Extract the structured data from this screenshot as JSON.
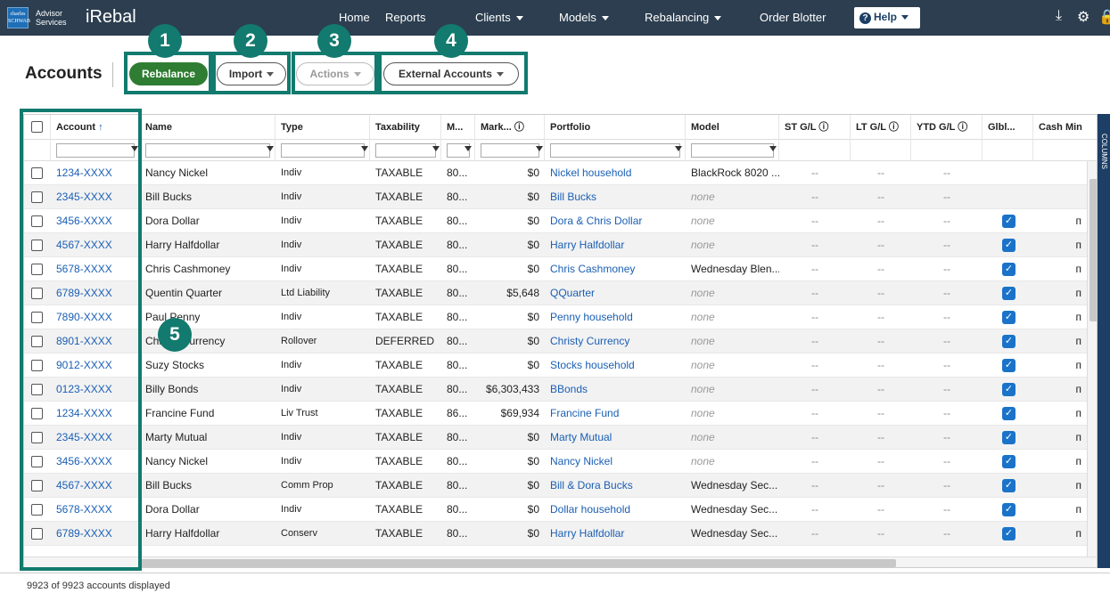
{
  "topnav": {
    "logo_text": "charles SCHWAB",
    "advisor_line1": "Advisor",
    "advisor_line2": "Services",
    "brand": "iRebal",
    "items": [
      {
        "label": "Home",
        "dropdown": false
      },
      {
        "label": "Reports",
        "dropdown": false
      },
      {
        "label": "Clients",
        "dropdown": true
      },
      {
        "label": "Models",
        "dropdown": true
      },
      {
        "label": "Rebalancing",
        "dropdown": true
      },
      {
        "label": "Order Blotter",
        "dropdown": false
      }
    ],
    "help_label": "Help",
    "icons": [
      "download-icon",
      "gear-icon",
      "lock-icon"
    ]
  },
  "callouts": [
    "1",
    "2",
    "3",
    "4",
    "5"
  ],
  "toolbar": {
    "title": "Accounts",
    "rebalance_label": "Rebalance",
    "import_label": "Import",
    "actions_label": "Actions",
    "external_label": "External Accounts"
  },
  "columns": [
    "Account",
    "Name",
    "Type",
    "Taxability",
    "M...",
    "Mark...",
    "Portfolio",
    "Model",
    "ST G/L",
    "LT G/L",
    "YTD G/L",
    "Glbl...",
    "Cash Min"
  ],
  "sort_indicator": "↑",
  "rows": [
    {
      "account": "1234-XXXX",
      "name": "Nancy Nickel",
      "type": "Indiv",
      "tax": "TAXABLE",
      "m": "80...",
      "mark": "$0",
      "portfolio": "Nickel household",
      "model": "BlackRock 8020 ...",
      "model_muted": false,
      "st": "--",
      "lt": "--",
      "ytd": "--",
      "glbl": false,
      "cash": ""
    },
    {
      "account": "2345-XXXX",
      "name": "Bill Bucks",
      "type": "Indiv",
      "tax": "TAXABLE",
      "m": "80...",
      "mark": "$0",
      "portfolio": "Bill Bucks",
      "model": "none",
      "model_muted": true,
      "st": "--",
      "lt": "--",
      "ytd": "--",
      "glbl": false,
      "cash": ""
    },
    {
      "account": "3456-XXXX",
      "name": "Dora Dollar",
      "type": "Indiv",
      "tax": "TAXABLE",
      "m": "80...",
      "mark": "$0",
      "portfolio": "Dora & Chris Dollar",
      "model": "none",
      "model_muted": true,
      "st": "--",
      "lt": "--",
      "ytd": "--",
      "glbl": true,
      "cash": "п"
    },
    {
      "account": "4567-XXXX",
      "name": "Harry Halfdollar",
      "type": "Indiv",
      "tax": "TAXABLE",
      "m": "80...",
      "mark": "$0",
      "portfolio": "Harry Halfdollar",
      "model": "none",
      "model_muted": true,
      "st": "--",
      "lt": "--",
      "ytd": "--",
      "glbl": true,
      "cash": "п"
    },
    {
      "account": "5678-XXXX",
      "name": "Chris Cashmoney",
      "type": "Indiv",
      "tax": "TAXABLE",
      "m": "80...",
      "mark": "$0",
      "portfolio": "Chris Cashmoney",
      "model": "Wednesday Blen...",
      "model_muted": false,
      "st": "--",
      "lt": "--",
      "ytd": "--",
      "glbl": true,
      "cash": "п"
    },
    {
      "account": "6789-XXXX",
      "name": "Quentin Quarter",
      "type": "Ltd Liability",
      "tax": "TAXABLE",
      "m": "80...",
      "mark": "$5,648",
      "portfolio": "QQuarter",
      "model": "none",
      "model_muted": true,
      "st": "--",
      "lt": "--",
      "ytd": "--",
      "glbl": true,
      "cash": "п"
    },
    {
      "account": "7890-XXXX",
      "name": "Paul Penny",
      "type": "Indiv",
      "tax": "TAXABLE",
      "m": "80...",
      "mark": "$0",
      "portfolio": "Penny household",
      "model": "none",
      "model_muted": true,
      "st": "--",
      "lt": "--",
      "ytd": "--",
      "glbl": true,
      "cash": "п"
    },
    {
      "account": "8901-XXXX",
      "name": "Christy Currency",
      "type": "Rollover",
      "tax": "DEFERRED",
      "m": "80...",
      "mark": "$0",
      "portfolio": "Christy Currency",
      "model": "none",
      "model_muted": true,
      "st": "--",
      "lt": "--",
      "ytd": "--",
      "glbl": true,
      "cash": "п"
    },
    {
      "account": "9012-XXXX",
      "name": "Suzy Stocks",
      "type": "Indiv",
      "tax": "TAXABLE",
      "m": "80...",
      "mark": "$0",
      "portfolio": "Stocks household",
      "model": "none",
      "model_muted": true,
      "st": "--",
      "lt": "--",
      "ytd": "--",
      "glbl": true,
      "cash": "п"
    },
    {
      "account": "0123-XXXX",
      "name": "Billy Bonds",
      "type": "Indiv",
      "tax": "TAXABLE",
      "m": "80...",
      "mark": "$6,303,433",
      "portfolio": "BBonds",
      "model": "none",
      "model_muted": true,
      "st": "--",
      "lt": "--",
      "ytd": "--",
      "glbl": true,
      "cash": "п"
    },
    {
      "account": "1234-XXXX",
      "name": "Francine Fund",
      "type": "Liv Trust",
      "tax": "TAXABLE",
      "m": "86...",
      "mark": "$69,934",
      "portfolio": "Francine Fund",
      "model": "none",
      "model_muted": true,
      "st": "--",
      "lt": "--",
      "ytd": "--",
      "glbl": true,
      "cash": "п"
    },
    {
      "account": "2345-XXXX",
      "name": "Marty Mutual",
      "type": "Indiv",
      "tax": "TAXABLE",
      "m": "80...",
      "mark": "$0",
      "portfolio": "Marty Mutual",
      "model": "none",
      "model_muted": true,
      "st": "--",
      "lt": "--",
      "ytd": "--",
      "glbl": true,
      "cash": "п"
    },
    {
      "account": "3456-XXXX",
      "name": "Nancy Nickel",
      "type": "Indiv",
      "tax": "TAXABLE",
      "m": "80...",
      "mark": "$0",
      "portfolio": "Nancy Nickel",
      "model": "none",
      "model_muted": true,
      "st": "--",
      "lt": "--",
      "ytd": "--",
      "glbl": true,
      "cash": "п"
    },
    {
      "account": "4567-XXXX",
      "name": "Bill Bucks",
      "type": "Comm Prop",
      "tax": "TAXABLE",
      "m": "80...",
      "mark": "$0",
      "portfolio": "Bill & Dora Bucks",
      "model": "Wednesday Sec...",
      "model_muted": false,
      "st": "--",
      "lt": "--",
      "ytd": "--",
      "glbl": true,
      "cash": "п"
    },
    {
      "account": "5678-XXXX",
      "name": "Dora Dollar",
      "type": "Indiv",
      "tax": "TAXABLE",
      "m": "80...",
      "mark": "$0",
      "portfolio": "Dollar household",
      "model": "Wednesday Sec...",
      "model_muted": false,
      "st": "--",
      "lt": "--",
      "ytd": "--",
      "glbl": true,
      "cash": "п"
    },
    {
      "account": "6789-XXXX",
      "name": "Harry Halfdollar",
      "type": "Conserv",
      "tax": "TAXABLE",
      "m": "80...",
      "mark": "$0",
      "portfolio": "Harry Halfdollar",
      "model": "Wednesday Sec...",
      "model_muted": false,
      "st": "--",
      "lt": "--",
      "ytd": "--",
      "glbl": true,
      "cash": "п"
    }
  ],
  "side_tab_label": "COLUMNS",
  "footer": "9923 of 9923 accounts displayed",
  "colors": {
    "nav_bg": "#2c3e50",
    "callout": "#127a6e",
    "rebalance": "#2e7d32",
    "link": "#1a5fb4",
    "checkbox_checked": "#1a73c9"
  }
}
